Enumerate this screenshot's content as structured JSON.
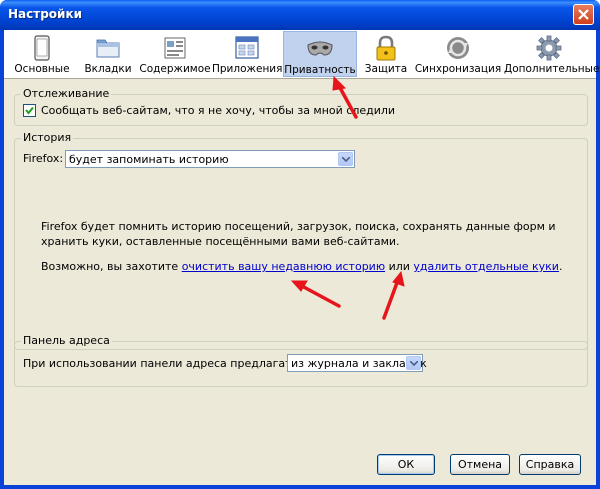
{
  "window": {
    "title": "Настройки"
  },
  "toolbar": {
    "panes": [
      {
        "label": "Основные",
        "icon": "general-icon"
      },
      {
        "label": "Вкладки",
        "icon": "tabs-icon"
      },
      {
        "label": "Содержимое",
        "icon": "content-icon"
      },
      {
        "label": "Приложения",
        "icon": "applications-icon"
      },
      {
        "label": "Приватность",
        "icon": "privacy-mask-icon",
        "selected": true
      },
      {
        "label": "Защита",
        "icon": "lock-icon"
      },
      {
        "label": "Синхронизация",
        "icon": "sync-icon"
      },
      {
        "label": "Дополнительные",
        "icon": "gear-icon"
      }
    ]
  },
  "tracking": {
    "legend": "Отслеживание",
    "dnt_label": "Сообщать веб-сайтам, что я не хочу, чтобы за мной следили",
    "dnt_checked": true
  },
  "history": {
    "legend": "История",
    "firefox_label": "Firefox:",
    "mode_value": "будет запоминать историю",
    "description": "Firefox будет помнить историю посещений, загрузок, поиска, сохранять данные форм и хранить куки, оставленные посещёнными вами веб-сайтами.",
    "maybe_prefix": "Возможно, вы захотите ",
    "clear_history_link": "очистить вашу недавнюю историю",
    "or_text": " или ",
    "remove_cookies_link": "удалить отдельные куки",
    "suffix": "."
  },
  "location_bar": {
    "legend": "Панель адреса",
    "suggest_label": "При использовании панели адреса предлагать ссылки:",
    "suggest_value": "из журнала и закладок"
  },
  "buttons": {
    "ok": "ОК",
    "cancel": "Отмена",
    "help": "Справка"
  },
  "colors": {
    "annotation_arrow": "#e8141c",
    "link": "#0000cc",
    "selected_pane": "#c1d2ee"
  }
}
